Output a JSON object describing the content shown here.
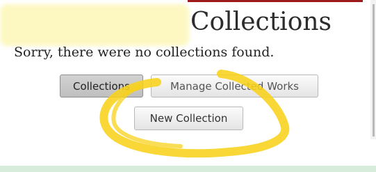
{
  "header": {
    "title": "Collections"
  },
  "main": {
    "empty_message": "Sorry, there were no collections found.",
    "buttons": {
      "collections_label": "Collections",
      "manage_label": "Manage Collected Works",
      "new_collection_label": "New Collection"
    }
  },
  "colors": {
    "top_bar": "#9e1b1b",
    "highlight_marker": "#f7d21b",
    "bottom_strip": "#d8ecdc"
  }
}
